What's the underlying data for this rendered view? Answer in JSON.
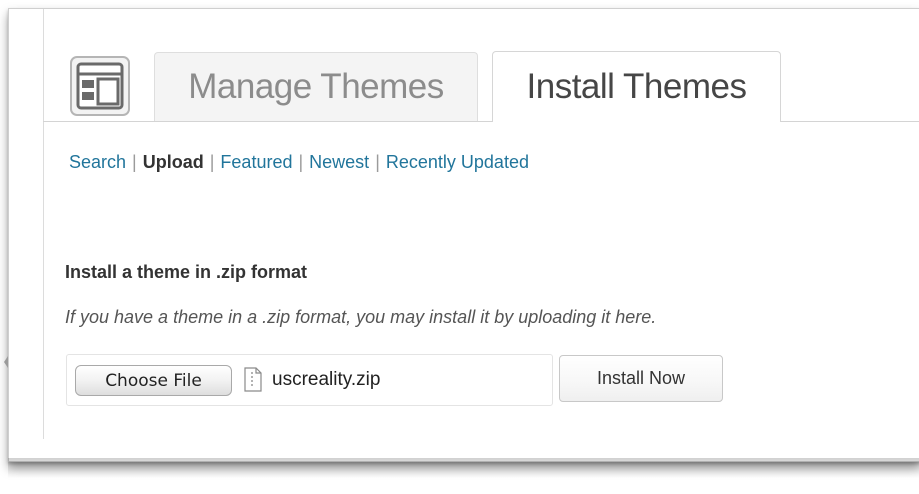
{
  "tabs": {
    "manage_label": "Manage Themes",
    "install_label": "Install Themes"
  },
  "subnav": {
    "items": [
      {
        "label": "Search",
        "current": false
      },
      {
        "label": "Upload",
        "current": true
      },
      {
        "label": "Featured",
        "current": false
      },
      {
        "label": "Newest",
        "current": false
      },
      {
        "label": "Recently Updated",
        "current": false
      }
    ],
    "separator": "|"
  },
  "upload": {
    "heading": "Install a theme in .zip format",
    "description": "If you have a theme in a .zip format, you may install it by uploading it here.",
    "choose_file_label": "Choose File",
    "file_name": "uscreality.zip",
    "install_button_label": "Install Now"
  },
  "colors": {
    "link": "#21759b",
    "current": "#333333",
    "tab_inactive_bg": "#f4f4f4"
  },
  "icons": {
    "theme_icon": "appearance-icon",
    "file_icon": "file-icon"
  }
}
